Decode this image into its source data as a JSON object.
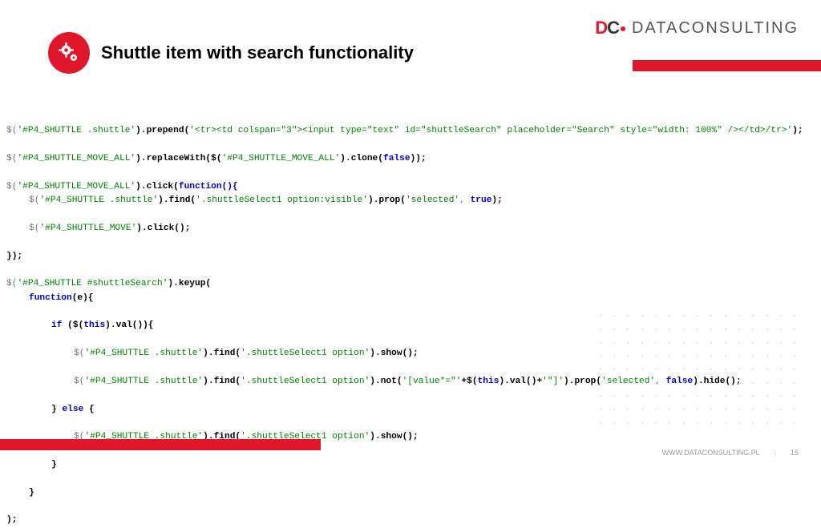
{
  "brand": {
    "mark_left": "D",
    "mark_right": "C",
    "name": "DATACONSULTING"
  },
  "title": "Shuttle item with search functionality",
  "footer": {
    "url": "WWW.DATACONSULTING.PL",
    "page": "15"
  },
  "code": {
    "l1_a": "$(",
    "l1_b": "'#P4_SHUTTLE .shuttle'",
    "l1_c": ").prepend(",
    "l1_d": "'<tr><td colspan=\"3\"><input type=\"text\" id=\"shuttleSearch\" placeholder=\"Search\" style=\"width: 100%\" /></td>/tr>'",
    "l1_e": ");",
    "l2_a": "$(",
    "l2_b": "'#P4_SHUTTLE_MOVE_ALL'",
    "l2_c": ").replaceWith($(",
    "l2_d": "'#P4_SHUTTLE_MOVE_ALL'",
    "l2_e": ").clone(",
    "l2_f": "false",
    "l2_g": "));",
    "l3_a": "$(",
    "l3_b": "'#P4_SHUTTLE_MOVE_ALL'",
    "l3_c": ").click(",
    "l3_d": "function(){",
    "l4_a": "$(",
    "l4_b": "'#P4_SHUTTLE .shuttle'",
    "l4_c": ").find(",
    "l4_d": "'.shuttleSelect1 option:visible'",
    "l4_e": ").prop(",
    "l4_f": "'selected'",
    "l4_g": ", ",
    "l4_h": "true",
    "l4_i": ");",
    "l5_a": "$(",
    "l5_b": "'#P4_SHUTTLE_MOVE'",
    "l5_c": ").click();",
    "l6": "});",
    "l7_a": "$(",
    "l7_b": "'#P4_SHUTTLE #shuttleSearch'",
    "l7_c": ").keyup(",
    "l8_a": "function",
    "l8_b": "(e){",
    "l9_a": "if ",
    "l9_b": "($(",
    "l9_c": "this",
    "l9_d": ").val()){",
    "l10_a": "$(",
    "l10_b": "'#P4_SHUTTLE .shuttle'",
    "l10_c": ").find(",
    "l10_d": "'.shuttleSelect1 option'",
    "l10_e": ").show();",
    "l11_a": "$(",
    "l11_b": "'#P4_SHUTTLE .shuttle'",
    "l11_c": ").find(",
    "l11_d": "'.shuttleSelect1 option'",
    "l11_e": ").not(",
    "l11_f": "'[value*=\"'",
    "l11_g": "+$(",
    "l11_h": "this",
    "l11_i": ").val()+",
    "l11_j": "'\"]'",
    "l11_k": ").prop(",
    "l11_l": "'selected'",
    "l11_m": ", ",
    "l11_n": "false",
    "l11_o": ").hide();",
    "l12_a": "} ",
    "l12_b": "else ",
    "l12_c": "{",
    "l13_a": "$(",
    "l13_b": "'#P4_SHUTTLE .shuttle'",
    "l13_c": ").find(",
    "l13_d": "'.shuttleSelect1 option'",
    "l13_e": ").show();",
    "l14": "}",
    "l15": "}",
    "l16": ");"
  }
}
